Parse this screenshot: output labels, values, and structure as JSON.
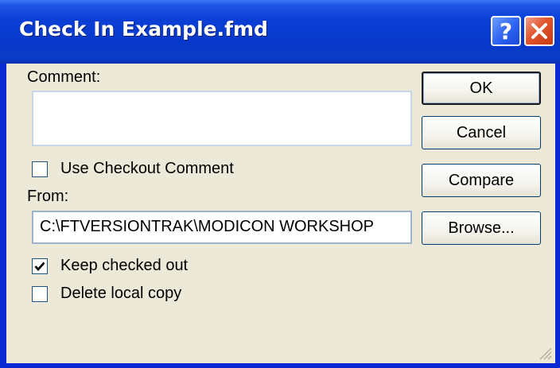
{
  "window": {
    "title": "Check In Example.fmd",
    "help_label": "?",
    "help_icon": "question-mark-icon",
    "close_icon": "close-x-icon"
  },
  "form": {
    "comment_label": "Comment:",
    "comment_value": "",
    "use_checkout_comment_label": "Use Checkout Comment",
    "use_checkout_comment_checked": false,
    "from_label": "From:",
    "from_value": "C:\\FTVERSIONTRAK\\MODICON WORKSHOP",
    "keep_checked_out_label": "Keep checked out",
    "keep_checked_out_checked": true,
    "delete_local_copy_label": "Delete local copy",
    "delete_local_copy_checked": false
  },
  "buttons": {
    "ok": "OK",
    "cancel": "Cancel",
    "compare": "Compare",
    "browse": "Browse..."
  },
  "colors": {
    "titlebar": "#0637c9",
    "client_background": "#ece9d8",
    "close_button": "#e2542c"
  }
}
